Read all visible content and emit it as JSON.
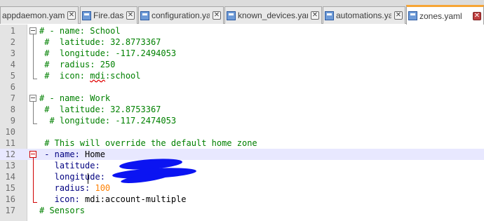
{
  "tabs": [
    {
      "label": "appdaemon.yaml",
      "active": false
    },
    {
      "label": "Fire.dash",
      "active": false
    },
    {
      "label": "configuration.yaml",
      "active": false
    },
    {
      "label": "known_devices.yaml",
      "active": false
    },
    {
      "label": "automations.yaml",
      "active": false
    },
    {
      "label": "zones.yaml",
      "active": true
    }
  ],
  "close_glyph": "✕",
  "editor": {
    "lines": [
      {
        "n": "1",
        "parts": [
          {
            "t": "# - name: School",
            "c": "comment"
          }
        ]
      },
      {
        "n": "2",
        "parts": [
          {
            "t": " #  latitude: 32.8773367",
            "c": "comment"
          }
        ]
      },
      {
        "n": "3",
        "parts": [
          {
            "t": " #  longitude: -117.2494053",
            "c": "comment"
          }
        ]
      },
      {
        "n": "4",
        "parts": [
          {
            "t": " #  radius: 250",
            "c": "comment"
          }
        ]
      },
      {
        "n": "5",
        "parts": [
          {
            "t": " #  icon: ",
            "c": "comment"
          },
          {
            "t": "mdi",
            "c": "comment squiggle"
          },
          {
            "t": ":school",
            "c": "comment"
          }
        ]
      },
      {
        "n": "6",
        "parts": []
      },
      {
        "n": "7",
        "parts": [
          {
            "t": "# - name: Work",
            "c": "comment"
          }
        ]
      },
      {
        "n": "8",
        "parts": [
          {
            "t": " #  latitude: 32.8753367",
            "c": "comment"
          }
        ]
      },
      {
        "n": "9",
        "parts": [
          {
            "t": "  # longitude: -117.2474053",
            "c": "comment"
          }
        ]
      },
      {
        "n": "10",
        "parts": []
      },
      {
        "n": "11",
        "parts": [
          {
            "t": " # This will override the default home zone",
            "c": "comment"
          }
        ]
      },
      {
        "n": "12",
        "parts": [
          {
            "t": " - name:",
            "c": "key"
          },
          {
            "t": " Home",
            "c": "plain"
          }
        ]
      },
      {
        "n": "13",
        "parts": [
          {
            "t": "   latitude:",
            "c": "key"
          }
        ]
      },
      {
        "n": "14",
        "parts": [
          {
            "t": "   longitude:",
            "c": "key"
          }
        ]
      },
      {
        "n": "15",
        "parts": [
          {
            "t": "   radius:",
            "c": "key"
          },
          {
            "t": " 100",
            "c": "num"
          }
        ]
      },
      {
        "n": "16",
        "parts": [
          {
            "t": "   icon:",
            "c": "key"
          },
          {
            "t": " mdi:account-multiple",
            "c": "plain"
          }
        ]
      },
      {
        "n": "17",
        "parts": [
          {
            "t": "# Sensors",
            "c": "comment"
          }
        ]
      }
    ]
  }
}
